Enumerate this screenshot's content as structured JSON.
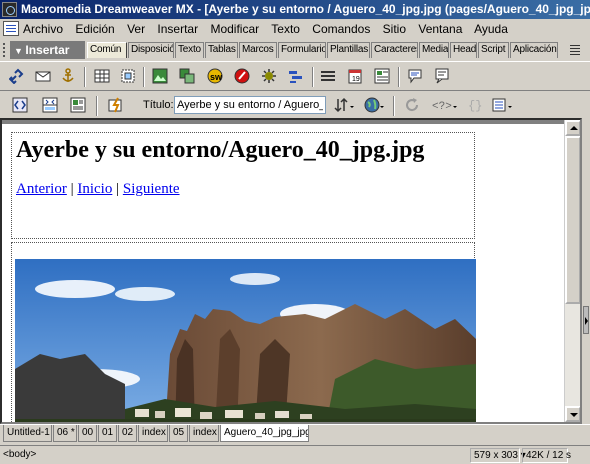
{
  "window": {
    "title": "Macromedia Dreamweaver MX - [Ayerbe y su entorno / Aguero_40_jpg.jpg (pages/Aguero_40_jpg_jp"
  },
  "menu": [
    "Archivo",
    "Edición",
    "Ver",
    "Insertar",
    "Modificar",
    "Texto",
    "Comandos",
    "Sitio",
    "Ventana",
    "Ayuda"
  ],
  "insert_panel": {
    "label": "Insertar",
    "tabs": [
      "Común",
      "Disposició",
      "Texto",
      "Tablas",
      "Marcos",
      "Formulario",
      "Plantillas",
      "Caracteres",
      "Media",
      "Head",
      "Script",
      "Aplicación"
    ],
    "active_tab": "Común"
  },
  "document_toolbar": {
    "title_label": "Título:",
    "title_value": "Ayerbe y su entorno / Aguero_"
  },
  "page": {
    "heading": "Ayerbe y su entorno/Aguero_40_jpg.jpg",
    "links": [
      "Anterior",
      "Inicio",
      "Siguiente"
    ],
    "separator": "|"
  },
  "document_tabs": [
    "Untitled-1",
    "06 *",
    "00",
    "01",
    "02",
    "index",
    "05",
    "index",
    "Aguero_40_jpg_jpg"
  ],
  "active_document_tab": "Aguero_40_jpg_jpg",
  "status": {
    "tag": "<body>",
    "window_size": "579 x 303",
    "download": "42K / 12 s"
  },
  "colors": {
    "title_bar": "#0a246a",
    "chrome": "#d4d0c8",
    "link": "#0000ee"
  }
}
